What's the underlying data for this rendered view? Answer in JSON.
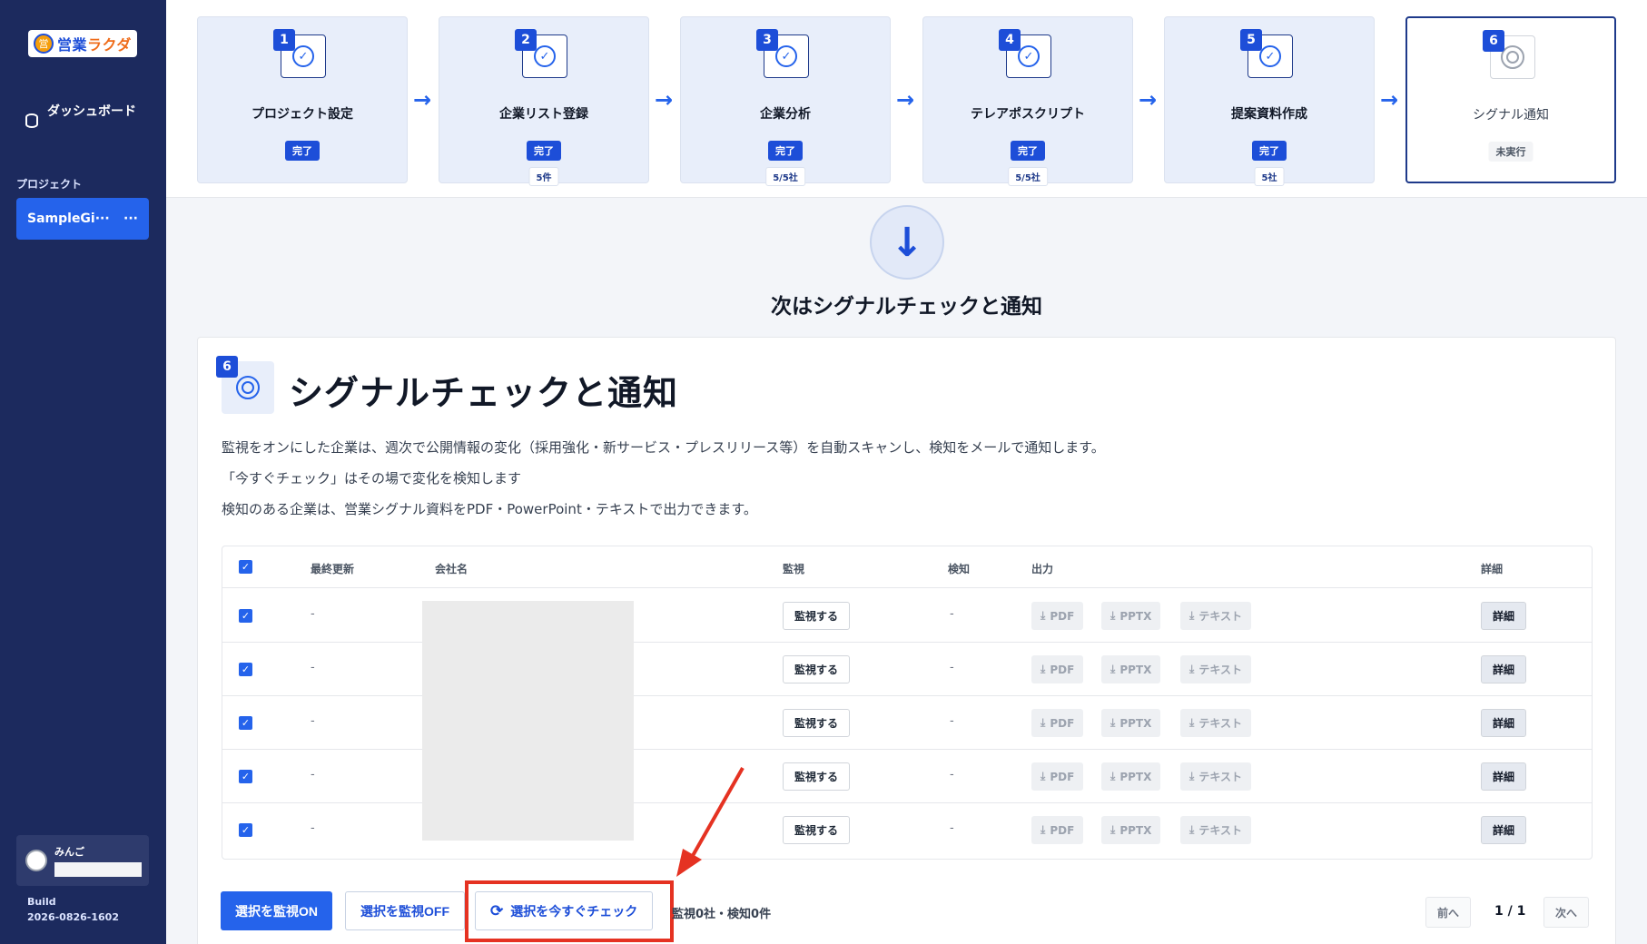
{
  "sidebar": {
    "logo_mark": "営",
    "logo_text_1": "営業",
    "logo_text_2": "ラクダ",
    "dashboard_label": "ダッシュボード",
    "section_label": "プロジェクト",
    "project_name": "SampleGi···",
    "project_menu": "···",
    "user_name": "みんご",
    "build_label": "Build",
    "build_version": "2026-0826-1602"
  },
  "steps": [
    {
      "num": "1",
      "title": "プロジェクト設定",
      "status": "完了",
      "count": ""
    },
    {
      "num": "2",
      "title": "企業リスト登録",
      "status": "完了",
      "count": "5件"
    },
    {
      "num": "3",
      "title": "企業分析",
      "status": "完了",
      "count": "5/5社"
    },
    {
      "num": "4",
      "title": "テレアポスクリプト",
      "status": "完了",
      "count": "5/5社"
    },
    {
      "num": "5",
      "title": "提案資料作成",
      "status": "完了",
      "count": "5社"
    },
    {
      "num": "6",
      "title": "シグナル通知",
      "status": "未実行",
      "count": ""
    }
  ],
  "next": {
    "title": "次はシグナルチェックと通知"
  },
  "panel": {
    "num": "6",
    "title": "シグナルチェックと通知",
    "desc_1": "監視をオンにした企業は、週次で公開情報の変化（採用強化・新サービス・プレスリリース等）を自動スキャンし、検知をメールで通知します。",
    "desc_2": "「今すぐチェック」はその場で変化を検知します",
    "desc_3": "検知のある企業は、営業シグナル資料をPDF・PowerPoint・テキストで出力できます。"
  },
  "table": {
    "headers": {
      "updated": "最終更新",
      "company": "会社名",
      "watch": "監視",
      "detect": "検知",
      "output": "出力",
      "detail": "詳細"
    },
    "rows": [
      {
        "updated": "-",
        "watch": "監視する",
        "detect": "-",
        "pdf": "PDF",
        "pptx": "PPTX",
        "text": "テキスト",
        "detail": "詳細"
      },
      {
        "updated": "-",
        "watch": "監視する",
        "detect": "-",
        "pdf": "PDF",
        "pptx": "PPTX",
        "text": "テキスト",
        "detail": "詳細"
      },
      {
        "updated": "-",
        "watch": "監視する",
        "detect": "-",
        "pdf": "PDF",
        "pptx": "PPTX",
        "text": "テキスト",
        "detail": "詳細"
      },
      {
        "updated": "-",
        "watch": "監視する",
        "detect": "-",
        "pdf": "PDF",
        "pptx": "PPTX",
        "text": "テキスト",
        "detail": "詳細"
      },
      {
        "updated": "-",
        "watch": "監視する",
        "detect": "-",
        "pdf": "PDF",
        "pptx": "PPTX",
        "text": "テキスト",
        "detail": "詳細"
      }
    ]
  },
  "actions": {
    "watch_on": "選択を監視ON",
    "watch_off": "選択を監視OFF",
    "check_now": "選択を今すぐチェック",
    "summary": "監視0社・検知0件",
    "prev": "前へ",
    "page": "1 / 1",
    "next": "次へ"
  },
  "colors": {
    "sidebar": "#1c2a5e",
    "primary": "#2563eb",
    "highlight": "#e53222"
  }
}
